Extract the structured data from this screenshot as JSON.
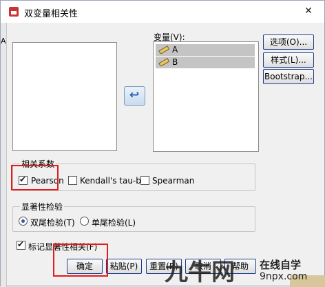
{
  "window": {
    "title": "双变量相关性",
    "close_glyph": "✕"
  },
  "left_strip": {
    "text": "A"
  },
  "variables": {
    "label": "变量(V):",
    "items": [
      {
        "name": "A"
      },
      {
        "name": "B"
      }
    ]
  },
  "side_buttons": {
    "options": "选项(O)...",
    "style": "样式(L)...",
    "bootstrap": "Bootstrap..."
  },
  "correlation": {
    "title": "相关系数",
    "pearson": "Pearson",
    "kendall": "Kendall's tau-b",
    "spearman": "Spearman",
    "pearson_checked": true,
    "kendall_checked": false,
    "spearman_checked": false
  },
  "significance": {
    "title": "显著性检验",
    "two_tailed": "双尾检验(T)",
    "one_tailed": "单尾检验(L)",
    "selected": "two_tailed"
  },
  "flag": {
    "label": "标记显著性相关(F)",
    "checked": true
  },
  "bottom_buttons": {
    "ok": "确定",
    "paste": "粘贴(P)",
    "reset": "重置(R)",
    "cancel": "取消",
    "help": "帮助"
  },
  "watermark": {
    "brand": "九牛网",
    "tag": "在线自学",
    "site": "9npx.com"
  },
  "colors": {
    "highlight_red": "#e31b1b",
    "button_border": "#1c3d8a",
    "selected_item": "#c4c4c4"
  }
}
